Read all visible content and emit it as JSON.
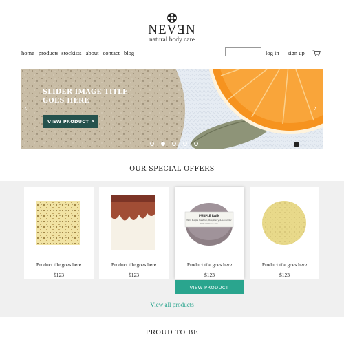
{
  "brand": {
    "name": "NEVƎN",
    "tagline": "natural body care"
  },
  "nav": {
    "items": [
      "home",
      "products",
      "stockists",
      "about",
      "contact",
      "blog"
    ]
  },
  "account": {
    "search_placeholder": "",
    "login": "log in",
    "signup": "sign up"
  },
  "hero": {
    "title_line1": "SLIDER IMAGE TITLE",
    "title_line2": "GOES HERE",
    "button": "VIEW PRODUCT",
    "slides": 5,
    "active_slide": 1
  },
  "offers": {
    "title": "OUR SPECIAL OFFERS",
    "products": [
      {
        "title": "Product tile goes here",
        "price": "$123"
      },
      {
        "title": "Product tile goes here",
        "price": "$123"
      },
      {
        "title": "Product tile goes here",
        "price": "$123",
        "label_line1": "PURPLE RAIN",
        "label_line2": "Wild Purple Heather, Raspberry & Lavender",
        "label_line3": "Natural Soap Bar"
      },
      {
        "title": "Product tile goes here",
        "price": "$123"
      }
    ],
    "hover_button": "VIEW PRODUCT",
    "view_all": "View all products"
  },
  "proud": {
    "title": "PROUD TO BE"
  },
  "colors": {
    "accent": "#2aa58e",
    "hero_button": "#25524d",
    "band": "#f0f0f0"
  },
  "icons": [
    "logo-mark-icon",
    "cart-icon",
    "chevron-right-icon",
    "arrow-left-icon",
    "arrow-right-icon"
  ]
}
